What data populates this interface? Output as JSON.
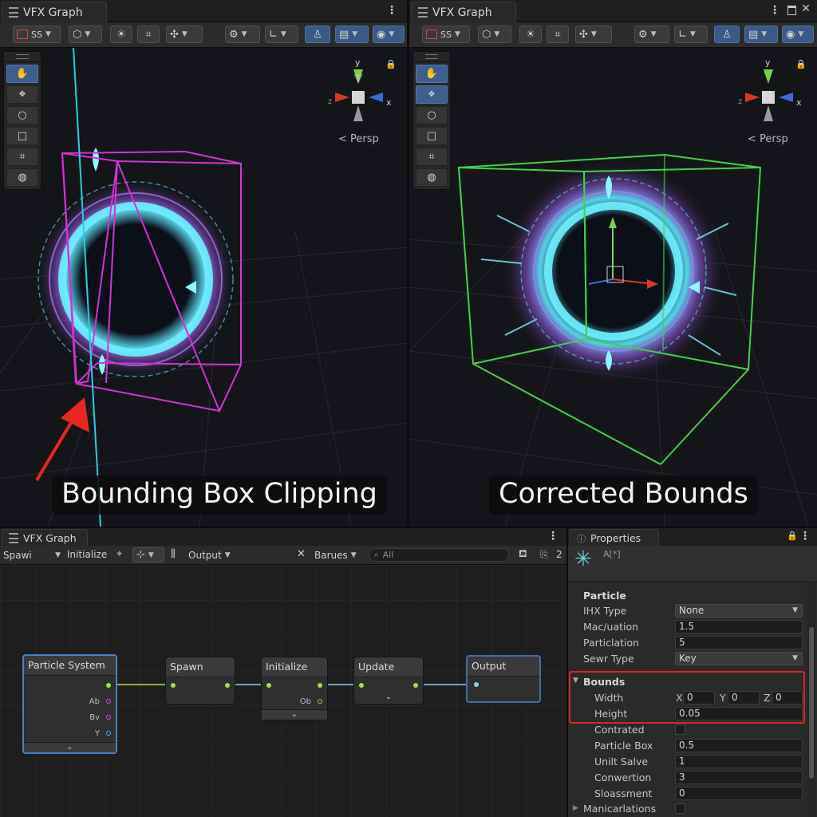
{
  "left_window": {
    "title": "VFX Graph",
    "toolbar": {
      "render_mode_label": "SS"
    },
    "persp_label": "< Persp",
    "caption": "Bounding Box Clipping"
  },
  "right_window": {
    "title": "VFX Graph",
    "toolbar": {
      "render_mode_label": "SS"
    },
    "persp_label": "< Persp",
    "caption": "Corrected Bounds"
  },
  "gizmo": {
    "y": "y",
    "x": "x",
    "z": "z"
  },
  "colors": {
    "clipped_bounds": "#d531d5",
    "corrected_bounds": "#3fd24a",
    "arrow": "#e8281e",
    "highlight": "#d6281c",
    "selection": "#4a7fbf"
  },
  "graph_window": {
    "title": "VFX Graph",
    "toolbar": {
      "spawn_label": "Spawi",
      "initialize_label": "Initialize",
      "output_label": "Output",
      "barues_label": "Barues",
      "search_placeholder": "All",
      "count_label": "2"
    },
    "nodes": {
      "particle_system": {
        "title": "Particle System",
        "ports": [
          "Ab",
          "Bv",
          "Y"
        ]
      },
      "spawn": {
        "title": "Spawn"
      },
      "initialize": {
        "title": "Initialize",
        "port": "Ob"
      },
      "update": {
        "title": "Update"
      },
      "output": {
        "title": "Output"
      }
    }
  },
  "properties": {
    "tab": "Properties",
    "subtitle": "A[*]",
    "section": "Particle",
    "rows": [
      {
        "label": "IHX Type",
        "value": "None"
      },
      {
        "label": "Mac/uation",
        "value": "1.5"
      },
      {
        "label": "Particlation",
        "value": "5"
      },
      {
        "label": "Sewr Type",
        "value": "Key"
      }
    ],
    "bounds": {
      "title": "Bounds",
      "width_label": "Width",
      "x_label": "X",
      "x_value": "0",
      "y_label": "Y",
      "y_value": "0",
      "z_label": "Z",
      "z_value": "0",
      "height_label": "Height",
      "height_value": "0.05"
    },
    "rows2": [
      {
        "label": "Contrated",
        "value": ""
      },
      {
        "label": "Particle Box",
        "value": "0.5"
      },
      {
        "label": "Unilt Salve",
        "value": "1"
      },
      {
        "label": "Conwertion",
        "value": "3"
      },
      {
        "label": "Sloassment",
        "value": "0"
      }
    ],
    "footer": "Manicarlations"
  }
}
